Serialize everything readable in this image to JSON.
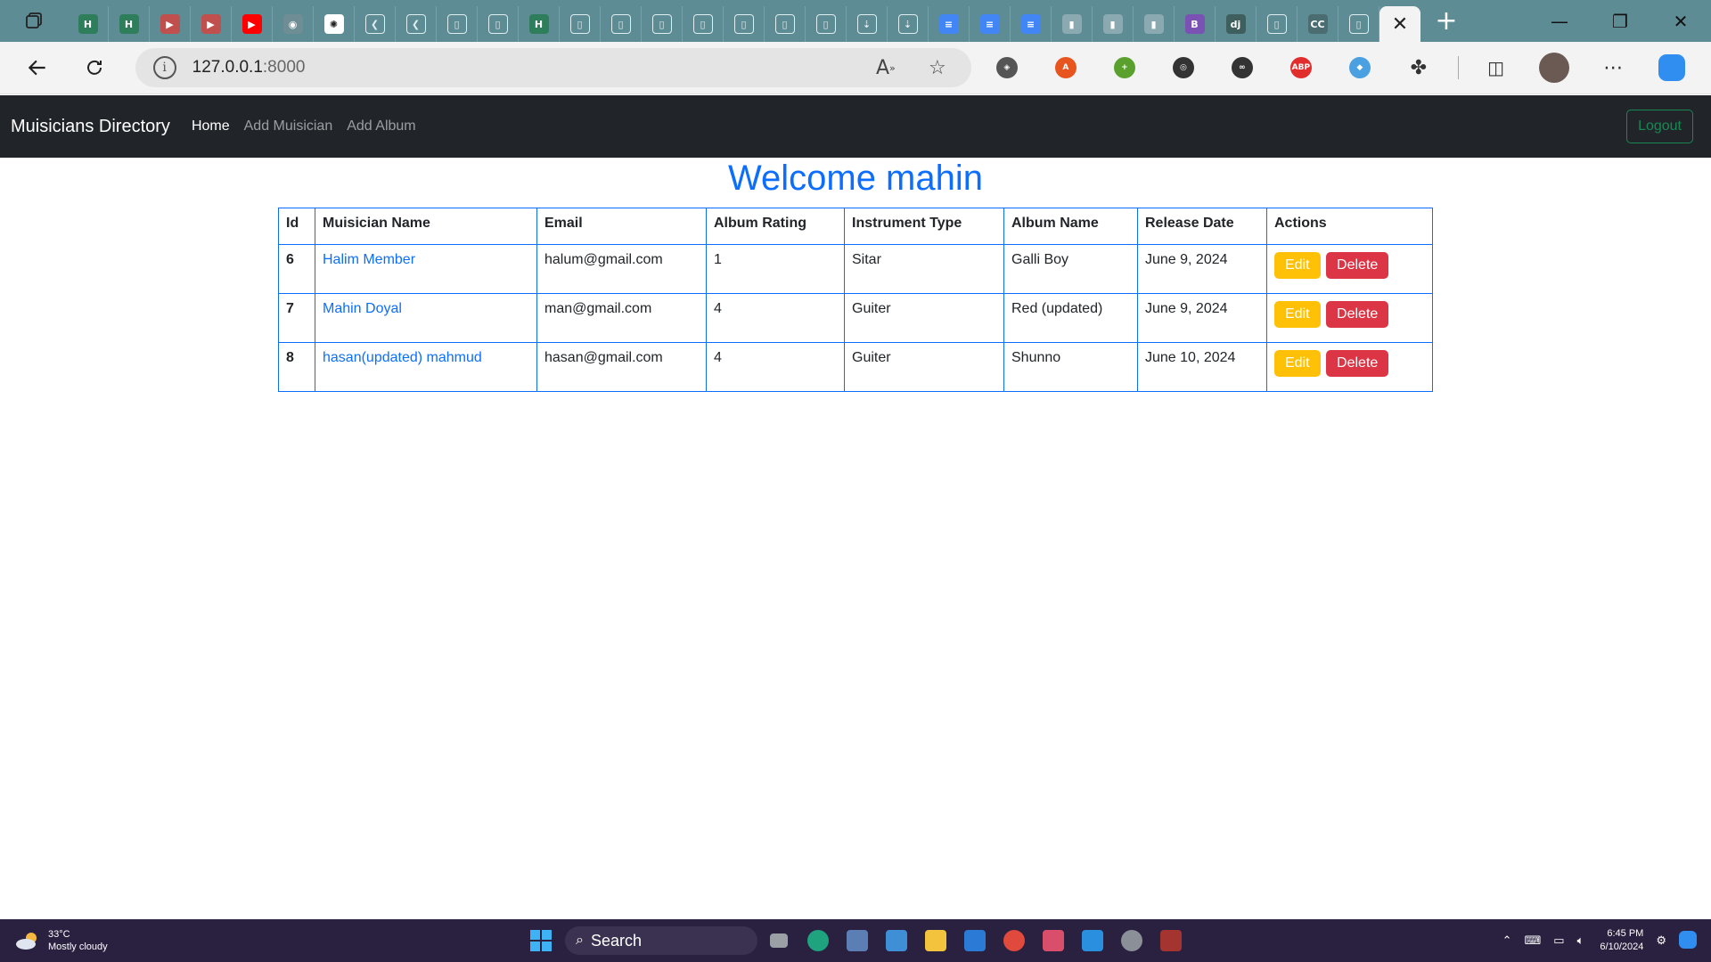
{
  "browser": {
    "url_host": "127.0.0.1",
    "url_port": ":8000",
    "tab_icons": [
      {
        "name": "hackerrank-tab-icon",
        "color": "#2e7d5b",
        "glyph": "H"
      },
      {
        "name": "hackerrank-tab-icon",
        "color": "#2e7d5b",
        "glyph": "H"
      },
      {
        "name": "youtube-tab-icon",
        "color": "#c0504d",
        "glyph": "▶"
      },
      {
        "name": "youtube-tab-icon",
        "color": "#c0504d",
        "glyph": "▶"
      },
      {
        "name": "youtube-tab-icon",
        "color": "#ff0000",
        "glyph": "▶"
      },
      {
        "name": "github-tab-icon",
        "color": "#6f8d94",
        "glyph": "◉"
      },
      {
        "name": "chatgpt-tab-icon",
        "color": "#ffffff",
        "glyph": "✺"
      },
      {
        "name": "back-arrow-tab-icon",
        "color": "#5d8c94",
        "glyph": "❮"
      },
      {
        "name": "back-arrow-tab-icon",
        "color": "#5d8c94",
        "glyph": "❮"
      },
      {
        "name": "page-tab-icon",
        "color": "#5d8c94",
        "glyph": "▯"
      },
      {
        "name": "page-tab-icon",
        "color": "#5d8c94",
        "glyph": "▯"
      },
      {
        "name": "hackerrank-tab-icon",
        "color": "#2e7d5b",
        "glyph": "H"
      },
      {
        "name": "page-tab-icon",
        "color": "#5d8c94",
        "glyph": "▯"
      },
      {
        "name": "page-tab-icon",
        "color": "#5d8c94",
        "glyph": "▯"
      },
      {
        "name": "page-tab-icon",
        "color": "#5d8c94",
        "glyph": "▯"
      },
      {
        "name": "page-tab-icon",
        "color": "#5d8c94",
        "glyph": "▯"
      },
      {
        "name": "page-tab-icon",
        "color": "#5d8c94",
        "glyph": "▯"
      },
      {
        "name": "page-tab-icon",
        "color": "#5d8c94",
        "glyph": "▯"
      },
      {
        "name": "page-tab-icon",
        "color": "#5d8c94",
        "glyph": "▯"
      },
      {
        "name": "download-tab-icon",
        "color": "#5d8c94",
        "glyph": "⇣"
      },
      {
        "name": "download-tab-icon",
        "color": "#5d8c94",
        "glyph": "⇣"
      },
      {
        "name": "docs-tab-icon",
        "color": "#4285f4",
        "glyph": "≡"
      },
      {
        "name": "docs-tab-icon",
        "color": "#4285f4",
        "glyph": "≡"
      },
      {
        "name": "docs-tab-icon",
        "color": "#4285f4",
        "glyph": "≡"
      },
      {
        "name": "chart-tab-icon",
        "color": "#8aa9b0",
        "glyph": "▮"
      },
      {
        "name": "chart-tab-icon",
        "color": "#8aa9b0",
        "glyph": "▮"
      },
      {
        "name": "chart-tab-icon",
        "color": "#8aa9b0",
        "glyph": "▮"
      },
      {
        "name": "bootstrap-tab-icon",
        "color": "#7952b3",
        "glyph": "B"
      },
      {
        "name": "django-tab-icon",
        "color": "#3f5f5f",
        "glyph": "dj"
      },
      {
        "name": "page-tab-icon",
        "color": "#5d8c94",
        "glyph": "▯"
      },
      {
        "name": "ccbv-tab-icon",
        "color": "#4b6c71",
        "glyph": "CC"
      },
      {
        "name": "page-tab-icon",
        "color": "#5d8c94",
        "glyph": "▯"
      }
    ],
    "extension_icons": [
      {
        "name": "brave-shield-icon",
        "color": "#555555",
        "glyph": "◈"
      },
      {
        "name": "translate-extension-icon",
        "color": "#e8541e",
        "glyph": "A"
      },
      {
        "name": "green-plus-extension-icon",
        "color": "#5aa02c",
        "glyph": "+"
      },
      {
        "name": "color-picker-extension-icon",
        "color": "#333333",
        "glyph": "◎"
      },
      {
        "name": "glasses-extension-icon",
        "color": "#333333",
        "glyph": "∞"
      },
      {
        "name": "adblock-plus-icon",
        "color": "#e22d2d",
        "glyph": "ABP"
      },
      {
        "name": "multi-color-extension-icon",
        "color": "#4aa0e0",
        "glyph": "◆"
      }
    ]
  },
  "navbar": {
    "brand": "Muisicians Directory",
    "links": [
      "Home",
      "Add Muisician",
      "Add Album"
    ],
    "logout_label": "Logout"
  },
  "main": {
    "welcome": "Welcome mahin",
    "table": {
      "headers": [
        "Id",
        "Muisician Name",
        "Email",
        "Album Rating",
        "Instrument Type",
        "Album Name",
        "Release Date",
        "Actions"
      ],
      "rows": [
        {
          "id": "6",
          "name": "Halim Member",
          "email": "halum@gmail.com",
          "rating": "1",
          "instrument": "Sitar",
          "album": "Galli Boy",
          "release": "June 9, 2024"
        },
        {
          "id": "7",
          "name": "Mahin Doyal",
          "email": "man@gmail.com",
          "rating": "4",
          "instrument": "Guiter",
          "album": "Red (updated)",
          "release": "June 9, 2024"
        },
        {
          "id": "8",
          "name": "hasan(updated) mahmud",
          "email": "hasan@gmail.com",
          "rating": "4",
          "instrument": "Guiter",
          "album": "Shunno",
          "release": "June 10, 2024"
        }
      ],
      "edit_label": "Edit",
      "delete_label": "Delete"
    }
  },
  "taskbar": {
    "temperature": "33°C",
    "weather": "Mostly cloudy",
    "search_label": "Search",
    "time": "6:45 PM",
    "date": "6/10/2024"
  }
}
